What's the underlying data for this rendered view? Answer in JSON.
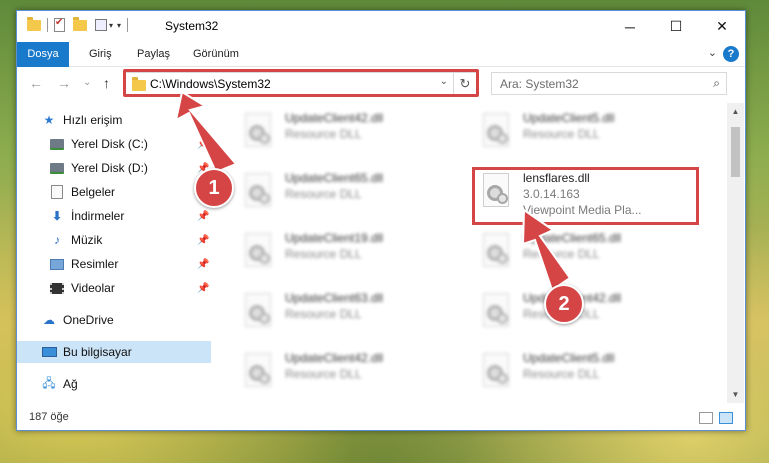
{
  "quick_access_toolbar": {
    "icons": [
      "folder-icon",
      "properties-check-icon",
      "new-folder-icon",
      "properties-icon",
      "customize-dropdown-icon"
    ]
  },
  "window": {
    "title": "System32",
    "controls": [
      "─",
      "☐",
      "✕"
    ]
  },
  "ribbon": {
    "tabs": [
      "Dosya",
      "Giriş",
      "Paylaş",
      "Görünüm"
    ],
    "help": "?",
    "expand": "⌄"
  },
  "address_bar": {
    "path": "C:\\Windows\\System32",
    "back": "←",
    "forward": "→",
    "recent": "⌄",
    "up": "↑",
    "dropdown": "⌄",
    "refresh": "↻"
  },
  "search": {
    "placeholder": "Ara: System32",
    "icon": "⌕"
  },
  "sidebar": {
    "items": [
      {
        "label": "Hızlı erişim",
        "icon": "star-icon",
        "pinned": false
      },
      {
        "label": "Yerel Disk (C:)",
        "icon": "drive-icon",
        "pinned": true
      },
      {
        "label": "Yerel Disk (D:)",
        "icon": "drive-icon",
        "pinned": true
      },
      {
        "label": "Belgeler",
        "icon": "documents-icon",
        "pinned": true
      },
      {
        "label": "İndirmeler",
        "icon": "download-icon",
        "pinned": true
      },
      {
        "label": "Müzik",
        "icon": "music-icon",
        "pinned": true
      },
      {
        "label": "Resimler",
        "icon": "pictures-icon",
        "pinned": true
      },
      {
        "label": "Videolar",
        "icon": "videos-icon",
        "pinned": true
      },
      {
        "label": "OneDrive",
        "icon": "cloud-icon",
        "pinned": false
      },
      {
        "label": "Bu bilgisayar",
        "icon": "pc-icon",
        "pinned": false,
        "selected": true
      },
      {
        "label": "Ağ",
        "icon": "network-icon",
        "pinned": false
      }
    ],
    "pin_glyph": "📌"
  },
  "files": {
    "left_column": [
      {
        "name": "UpdateClient42.dll",
        "desc": "Resource DLL"
      },
      {
        "name": "UpdateClient65.dll",
        "desc": "Resource DLL"
      },
      {
        "name": "UpdateClient19.dll",
        "desc": "Resource DLL"
      },
      {
        "name": "UpdateClient63.dll",
        "desc": "Resource DLL"
      },
      {
        "name": "UpdateClient42.dll",
        "desc": "Resource DLL"
      }
    ],
    "right_column": [
      {
        "name": "UpdateClient5.dll",
        "desc": "Resource DLL"
      },
      {
        "name": "lensflares.dll",
        "desc": "3.0.14.163",
        "desc2": "Viewpoint Media Pla..."
      },
      {
        "name": "UpdateClient65.dll",
        "desc": "Resource DLL"
      },
      {
        "name": "UpdateClient42.dll",
        "desc": "Resource DLL"
      },
      {
        "name": "UpdateClient5.dll",
        "desc": "Resource DLL"
      }
    ]
  },
  "status_bar": {
    "count": "187 öğe"
  },
  "callouts": [
    "1",
    "2"
  ],
  "colors": {
    "accent": "#1979ca",
    "highlight": "#d64545",
    "selected": "#cce4f7"
  }
}
